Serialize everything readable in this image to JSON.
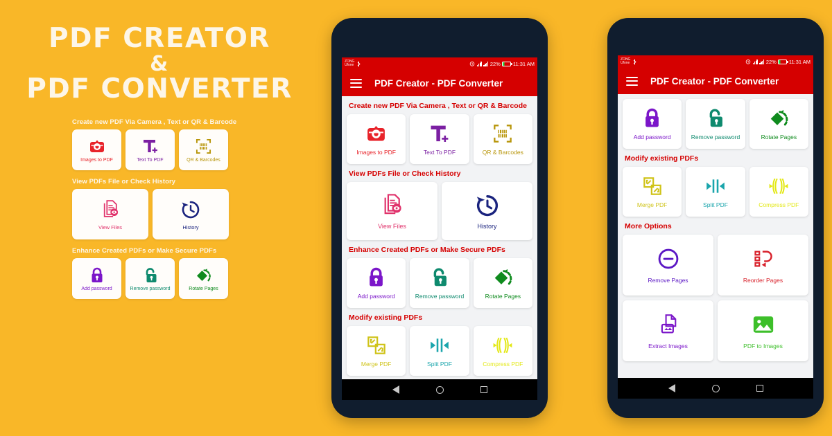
{
  "theme": {
    "background": "#f9b728",
    "app_red": "#d50000",
    "promo_text": "#fdf6e8",
    "phone_frame": "#101d2e",
    "screen_bg": "#f2f3f5"
  },
  "promo": {
    "line1": "PDF CREATOR",
    "ampersand": "&",
    "line2": "PDF CONVERTER",
    "sections": [
      {
        "title": "Create new PDF Via Camera , Text or QR & Barcode",
        "cards": [
          {
            "label": "Images to PDF",
            "icon": "camera-icon",
            "color": "#e8232a"
          },
          {
            "label": "Text To PDF",
            "icon": "text-t-plus-icon",
            "color": "#7b1fa2"
          },
          {
            "label": "QR & Barcodes",
            "icon": "qr-barcode-scan-icon",
            "color": "#b8960b"
          }
        ]
      },
      {
        "title": "View PDFs File or Check History",
        "cards": [
          {
            "label": "View Files",
            "icon": "documents-eye-icon",
            "color": "#e0326b"
          },
          {
            "label": "History",
            "icon": "clock-rewind-icon",
            "color": "#1a237e"
          }
        ]
      },
      {
        "title": "Enhance Created PDFs or Make Secure PDFs",
        "cards": [
          {
            "label": "Add password",
            "icon": "lock-closed-icon",
            "color": "#7b16c9"
          },
          {
            "label": "Remove password",
            "icon": "lock-open-icon",
            "color": "#0e8a6e"
          },
          {
            "label": "Rotate Pages",
            "icon": "rotate-pages-icon",
            "color": "#0f8b1e"
          }
        ]
      }
    ]
  },
  "phone1": {
    "statusbar": {
      "carrier_line1": "ZONG",
      "carrier_line2": "Ufone",
      "battery_percent": "22%",
      "time": "11:31 AM"
    },
    "appbar": {
      "title": "PDF Creator - PDF Converter",
      "menu_icon": "hamburger-menu-icon"
    },
    "sections": [
      {
        "title": "Create new PDF Via Camera , Text or QR & Barcode",
        "cards": [
          {
            "label": "Images to PDF",
            "icon": "camera-icon",
            "color": "#e8232a"
          },
          {
            "label": "Text To PDF",
            "icon": "text-t-plus-icon",
            "color": "#7b1fa2"
          },
          {
            "label": "QR & Barcodes",
            "icon": "qr-barcode-scan-icon",
            "color": "#b8960b"
          }
        ]
      },
      {
        "title": "View PDFs File or Check History",
        "cards": [
          {
            "label": "View Files",
            "icon": "documents-eye-icon",
            "color": "#e0326b"
          },
          {
            "label": "History",
            "icon": "clock-rewind-icon",
            "color": "#1a237e"
          }
        ]
      },
      {
        "title": "Enhance Created PDFs or Make Secure PDFs",
        "cards": [
          {
            "label": "Add password",
            "icon": "lock-closed-icon",
            "color": "#7b16c9"
          },
          {
            "label": "Remove password",
            "icon": "lock-open-icon",
            "color": "#0e8a6e"
          },
          {
            "label": "Rotate Pages",
            "icon": "rotate-pages-icon",
            "color": "#0f8b1e"
          }
        ]
      },
      {
        "title": "Modify existing PDFs",
        "cards": [
          {
            "label": "Merge PDF",
            "icon": "merge-squares-icon",
            "color": "#cfc318"
          },
          {
            "label": "Split PDF",
            "icon": "split-arrows-icon",
            "color": "#1aa5ac"
          },
          {
            "label": "Compress PDF",
            "icon": "compress-icon",
            "color": "#e3e815"
          }
        ]
      }
    ],
    "navbar": {
      "back": "nav-back-icon",
      "home": "nav-home-icon",
      "recents": "nav-recents-icon"
    }
  },
  "phone2": {
    "statusbar": {
      "carrier_line1": "ZONG",
      "carrier_line2": "Ufone",
      "battery_percent": "22%",
      "time": "11:31 AM"
    },
    "appbar": {
      "title": "PDF Creator - PDF Converter",
      "menu_icon": "hamburger-menu-icon"
    },
    "sections": [
      {
        "title": "",
        "cards": [
          {
            "label": "Add password",
            "icon": "lock-closed-icon",
            "color": "#7b16c9"
          },
          {
            "label": "Remove password",
            "icon": "lock-open-icon",
            "color": "#0e8a6e"
          },
          {
            "label": "Rotate Pages",
            "icon": "rotate-pages-icon",
            "color": "#0f8b1e"
          }
        ]
      },
      {
        "title": "Modify existing PDFs",
        "cards": [
          {
            "label": "Merge PDF",
            "icon": "merge-squares-icon",
            "color": "#cfc318"
          },
          {
            "label": "Split PDF",
            "icon": "split-arrows-icon",
            "color": "#1aa5ac"
          },
          {
            "label": "Compress PDF",
            "icon": "compress-icon",
            "color": "#e3e815"
          }
        ]
      },
      {
        "title": "More Options",
        "cards": [
          {
            "label": "Remove Pages",
            "icon": "minus-circle-icon",
            "color": "#5b17c4"
          },
          {
            "label": "Reorder Pages",
            "icon": "reorder-pages-icon",
            "color": "#d8202a"
          }
        ]
      },
      {
        "title": "",
        "cards": [
          {
            "label": "Extract Images",
            "icon": "extract-images-icon",
            "color": "#7b16c9"
          },
          {
            "label": "PDF to Images",
            "icon": "photo-icon",
            "color": "#3dbf2a"
          }
        ]
      }
    ],
    "navbar": {
      "back": "nav-back-icon",
      "home": "nav-home-icon",
      "recents": "nav-recents-icon"
    }
  }
}
